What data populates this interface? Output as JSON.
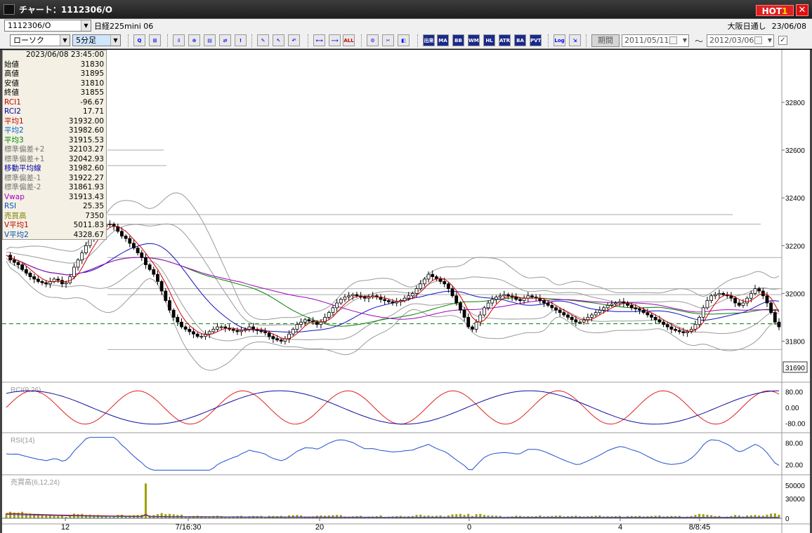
{
  "window": {
    "title": "チャート：1112306/O",
    "hot_label": "HOT",
    "hot_num": "1",
    "close_glyph": "✕"
  },
  "toolbar_top": {
    "symbol_code": "1112306/O",
    "symbol_name": "日経225mini 06",
    "session": "大阪日通し",
    "date": "23/06/08"
  },
  "toolbar": {
    "chart_type": "ローソク",
    "interval": "5分足",
    "period_button": "期間",
    "start_date": "2011/05/11",
    "range_sep": "～",
    "end_date": "2012/03/06",
    "check_mark": "✓",
    "buttons": [
      {
        "name": "search-icon",
        "glyph": "Q"
      },
      {
        "name": "grid-icon",
        "glyph": "⊞"
      },
      {
        "name": "download-icon",
        "glyph": "⇩"
      },
      {
        "name": "zoom-icon",
        "glyph": "⊕"
      },
      {
        "name": "chart-icon",
        "glyph": "▤"
      },
      {
        "name": "compare-icon",
        "glyph": "⇄"
      },
      {
        "name": "alert-icon",
        "glyph": "!"
      },
      {
        "name": "pencil-icon",
        "glyph": "✎"
      },
      {
        "name": "cursor-icon",
        "glyph": "↖"
      },
      {
        "name": "undo-icon",
        "glyph": "↶"
      },
      {
        "name": "expand-icon",
        "glyph": "⟷"
      },
      {
        "name": "shrink-icon",
        "glyph": "⟶"
      },
      {
        "name": "all-button",
        "glyph": "ALL"
      },
      {
        "name": "settings-icon",
        "glyph": "⚙"
      },
      {
        "name": "tool-icon",
        "glyph": "✂"
      },
      {
        "name": "color-icon",
        "glyph": "◧"
      },
      {
        "name": "volume-button",
        "glyph": "出来"
      },
      {
        "name": "ma-button",
        "glyph": "MA"
      },
      {
        "name": "bb-button",
        "glyph": "BB"
      },
      {
        "name": "wma-button",
        "glyph": "WMA"
      },
      {
        "name": "hl-button",
        "glyph": "HL"
      },
      {
        "name": "atr-button",
        "glyph": "ATR"
      },
      {
        "name": "ba-button",
        "glyph": "BA"
      },
      {
        "name": "pvt-button",
        "glyph": "PVT"
      },
      {
        "name": "log-button",
        "glyph": "Log"
      },
      {
        "name": "export-icon",
        "glyph": "⇲"
      }
    ]
  },
  "info_panel": {
    "datetime": "2023/06/08  23:45:00",
    "rows": [
      {
        "k": "始値",
        "v": "31830",
        "c": "#000"
      },
      {
        "k": "高値",
        "v": "31895",
        "c": "#000"
      },
      {
        "k": "安値",
        "v": "31810",
        "c": "#000"
      },
      {
        "k": "終値",
        "v": "31855",
        "c": "#000"
      },
      {
        "k": "RCI1",
        "v": "-96.67",
        "c": "#c00000"
      },
      {
        "k": "RCI2",
        "v": "17.71",
        "c": "#0000a0"
      },
      {
        "k": "平均1",
        "v": "31932.00",
        "c": "#c00000"
      },
      {
        "k": "平均2",
        "v": "31982.60",
        "c": "#0060d0"
      },
      {
        "k": "平均3",
        "v": "31915.53",
        "c": "#008000"
      },
      {
        "k": "標準偏差+2",
        "v": "32103.27",
        "c": "#777"
      },
      {
        "k": "標準偏差+1",
        "v": "32042.93",
        "c": "#777"
      },
      {
        "k": "移動平均線",
        "v": "31982.60",
        "c": "#0000a0"
      },
      {
        "k": "標準偏差-1",
        "v": "31922.27",
        "c": "#777"
      },
      {
        "k": "標準偏差-2",
        "v": "31861.93",
        "c": "#777"
      },
      {
        "k": "Vwap",
        "v": "31913.43",
        "c": "#a000c0"
      },
      {
        "k": "RSI",
        "v": "25.35",
        "c": "#0050c0"
      },
      {
        "k": "売買高",
        "v": "7350",
        "c": "#808000"
      },
      {
        "k": "V平均1",
        "v": "5011.83",
        "c": "#c00000"
      },
      {
        "k": "V平均2",
        "v": "4328.67",
        "c": "#0050c0"
      }
    ]
  },
  "chart_data": [
    {
      "type": "candlestick",
      "y_ticks": [
        "32800",
        "32600",
        "32400",
        "32200",
        "32000",
        "31800"
      ],
      "ylim": [
        31640,
        33020
      ],
      "current_price": "31690",
      "x_labels": [
        "12",
        "7/16:30",
        "20",
        "0",
        "4",
        "8/8:45"
      ],
      "reference_line": 31873,
      "series": [
        {
          "name": "平均1",
          "color": "#c00000"
        },
        {
          "name": "平均2",
          "color": "#1010c0"
        },
        {
          "name": "平均3",
          "color": "#008000"
        },
        {
          "name": "Vwap",
          "color": "#a000c0"
        },
        {
          "name": "標準偏差±1",
          "color": "#999999"
        },
        {
          "name": "標準偏差±2",
          "color": "#999999"
        }
      ],
      "close_series": [
        32160,
        32140,
        32130,
        32120,
        32100,
        32085,
        32070,
        32060,
        32050,
        32045,
        32040,
        32050,
        32060,
        32055,
        32040,
        32045,
        32070,
        32110,
        32140,
        32170,
        32200,
        32230,
        32250,
        32270,
        32280,
        32290,
        32290,
        32280,
        32260,
        32240,
        32230,
        32210,
        32190,
        32170,
        32150,
        32120,
        32100,
        32080,
        32050,
        32010,
        31970,
        31930,
        31900,
        31880,
        31860,
        31850,
        31840,
        31830,
        31820,
        31820,
        31830,
        31840,
        31850,
        31860,
        31860,
        31855,
        31850,
        31845,
        31840,
        31845,
        31850,
        31860,
        31850,
        31845,
        31840,
        31835,
        31820,
        31810,
        31805,
        31800,
        31810,
        31830,
        31850,
        31870,
        31880,
        31890,
        31885,
        31880,
        31870,
        31880,
        31900,
        31920,
        31940,
        31960,
        31975,
        31985,
        31990,
        31995,
        31990,
        31985,
        31980,
        31985,
        31990,
        31985,
        31975,
        31970,
        31965,
        31960,
        31965,
        31970,
        31980,
        31990,
        32000,
        32020,
        32040,
        32060,
        32080,
        32070,
        32060,
        32050,
        32040,
        32020,
        31990,
        31960,
        31930,
        31900,
        31860,
        31850,
        31880,
        31910,
        31940,
        31960,
        31975,
        31985,
        31990,
        31995,
        31990,
        31985,
        31975,
        31970,
        31980,
        31990,
        31985,
        31980,
        31970,
        31960,
        31950,
        31940,
        31930,
        31920,
        31910,
        31900,
        31890,
        31880,
        31880,
        31890,
        31900,
        31910,
        31920,
        31930,
        31940,
        31950,
        31955,
        31960,
        31965,
        31960,
        31950,
        31940,
        31935,
        31930,
        31920,
        31910,
        31900,
        31890,
        31880,
        31870,
        31860,
        31850,
        31845,
        31840,
        31835,
        31840,
        31850,
        31870,
        31900,
        31940,
        31970,
        31990,
        31995,
        32000,
        31995,
        31990,
        31980,
        31960,
        31950,
        31960,
        31980,
        32000,
        32020,
        32010,
        31990,
        31960,
        31920,
        31880,
        31860
      ]
    },
    {
      "type": "line",
      "label": "RCI(9,26)",
      "y_ticks": [
        "80.00",
        "0.00",
        "-80.00"
      ],
      "series": [
        {
          "name": "RCI1",
          "color": "#e02020"
        },
        {
          "name": "RCI2",
          "color": "#1010a0"
        }
      ]
    },
    {
      "type": "line",
      "label": "RSI(14)",
      "y_ticks": [
        "80.00",
        "20.00"
      ],
      "series": [
        {
          "name": "RSI",
          "color": "#2050d0"
        }
      ]
    },
    {
      "type": "bar",
      "label": "売買高(6,12,24)",
      "y_ticks": [
        "50000",
        "30000",
        "0"
      ],
      "series": [
        {
          "name": "売買高",
          "color": "#a0a000"
        },
        {
          "name": "V平均1",
          "color": "#c00000"
        },
        {
          "name": "V平均2",
          "color": "#2050d0"
        }
      ]
    }
  ]
}
